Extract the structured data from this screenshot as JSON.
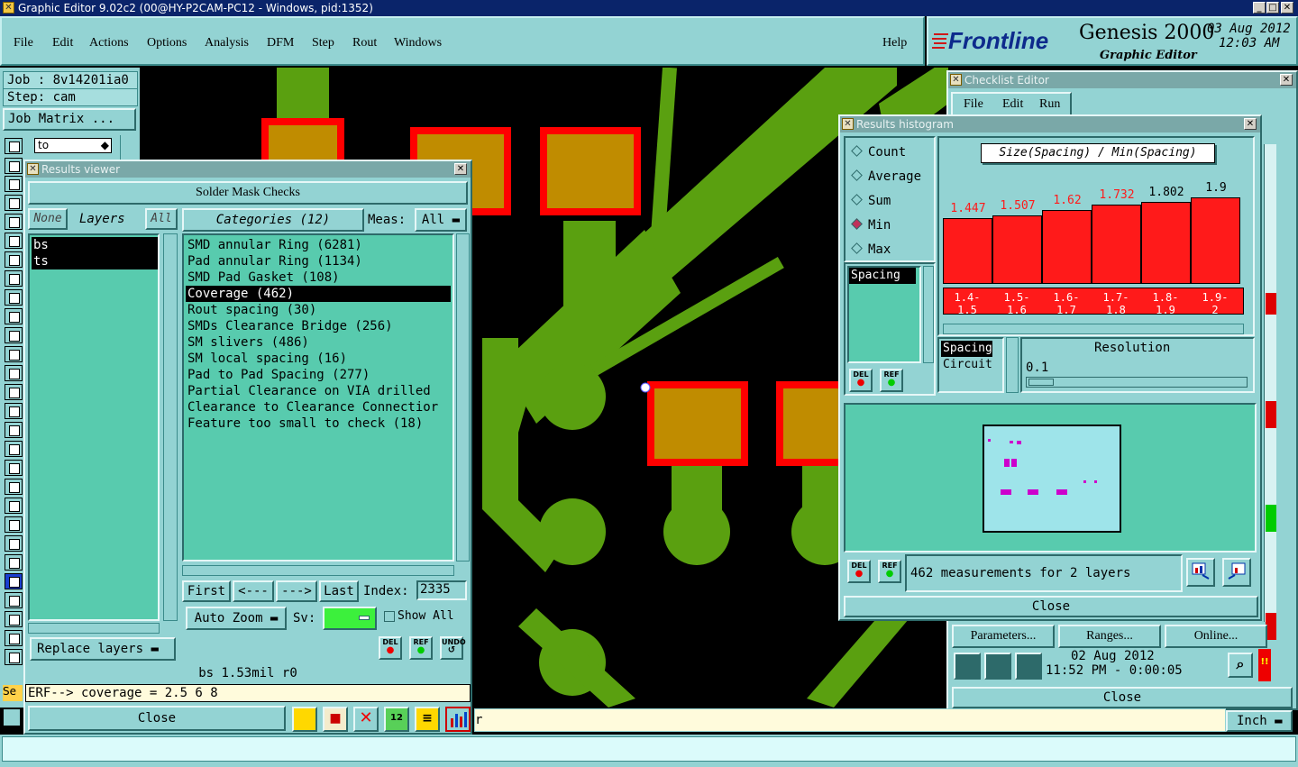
{
  "app": {
    "window_title": "Graphic Editor 9.02c2 (00@HY-P2CAM-PC12 - Windows, pid:1352)",
    "menu": [
      "File",
      "Edit",
      "Actions",
      "Options",
      "Analysis",
      "DFM",
      "Step",
      "Rout",
      "Windows"
    ],
    "help": "Help",
    "brand": "Frontline",
    "product": "Genesis 2000",
    "subtitle": "Graphic Editor",
    "date": "03 Aug 2012",
    "time": "12:03 AM"
  },
  "left_panel": {
    "job": "Job : 8v14201ia0",
    "step": "Step: cam",
    "job_matrix": "Job Matrix ...",
    "to_field": "to",
    "se_label": "Se"
  },
  "results_viewer": {
    "title": "Results viewer",
    "header": "Solder Mask Checks",
    "none": "None",
    "layers": "Layers",
    "all": "All",
    "categories_label": "Categories (12)",
    "meas_label": "Meas:",
    "meas_value": "All",
    "layer_items": [
      "bs",
      "ts"
    ],
    "categories": [
      "SMD annular Ring (6281)",
      "Pad annular Ring (1134)",
      "SMD Pad Gasket (108)",
      "Coverage (462)",
      "Rout spacing (30)",
      "SMDs Clearance Bridge (256)",
      "SM slivers (486)",
      "SM local spacing (16)",
      "Pad to Pad Spacing (277)",
      "Partial Clearance on VIA drilled",
      "Clearance to Clearance Connectior",
      "Feature too small to check (18)"
    ],
    "selected_category": 3,
    "nav": {
      "first": "First",
      "prev": "<---",
      "next": "--->",
      "last": "Last",
      "index_label": "Index:",
      "index_value": "2335"
    },
    "auto_zoom": "Auto Zoom",
    "sv_label": "Sv:",
    "show_all": "Show All",
    "replace_layers": "Replace layers",
    "del": "DEL",
    "ref": "REF",
    "undo": "UNDO",
    "status": "bs 1.53mil  r0",
    "erf": "ERF--> coverage = 2.5 6 8",
    "close": "Close"
  },
  "checklist_editor": {
    "title": "Checklist Editor",
    "menu": [
      "File",
      "Edit",
      "Run"
    ],
    "parameters": "Parameters...",
    "ranges": "Ranges...",
    "online": "Online...",
    "date": "02 Aug 2012",
    "time": "11:52 PM - 0:00:05",
    "close": "Close"
  },
  "histogram": {
    "title": "Results histogram",
    "stat_options": [
      "Count",
      "Average",
      "Sum",
      "Min",
      "Max"
    ],
    "selected_stat": "Min",
    "chart_title": "Size(Spacing) / Min(Spacing)",
    "measure_list": [
      "Spacing"
    ],
    "measure_list2": [
      "Spacing",
      "Circuit"
    ],
    "resolution_label": "Resolution",
    "resolution_value": "0.1",
    "summary": "462 measurements for 2 layers",
    "close": "Close",
    "del": "DEL",
    "ref": "REF"
  },
  "chart_data": {
    "type": "bar",
    "title": "Size(Spacing) / Min(Spacing)",
    "categories": [
      "1.4-1.5",
      "1.5-1.6",
      "1.6-1.7",
      "1.7-1.8",
      "1.8-1.9",
      "1.9-2"
    ],
    "values": [
      1.447,
      1.507,
      1.62,
      1.732,
      1.802,
      1.9
    ],
    "value_colors": [
      "#ff1a1a",
      "#ff1a1a",
      "#ff1a1a",
      "#ff1a1a",
      "#000000",
      "#000000"
    ],
    "bar_color": "#ff1a1a"
  },
  "bottom": {
    "unit": "Inch",
    "prompt_tail": "r"
  },
  "colors": {
    "panel": "#93d3d3",
    "list_bg": "#58cbae",
    "copper": "#5aa010",
    "pad": "#c08c00",
    "mask": "#ff0000"
  }
}
